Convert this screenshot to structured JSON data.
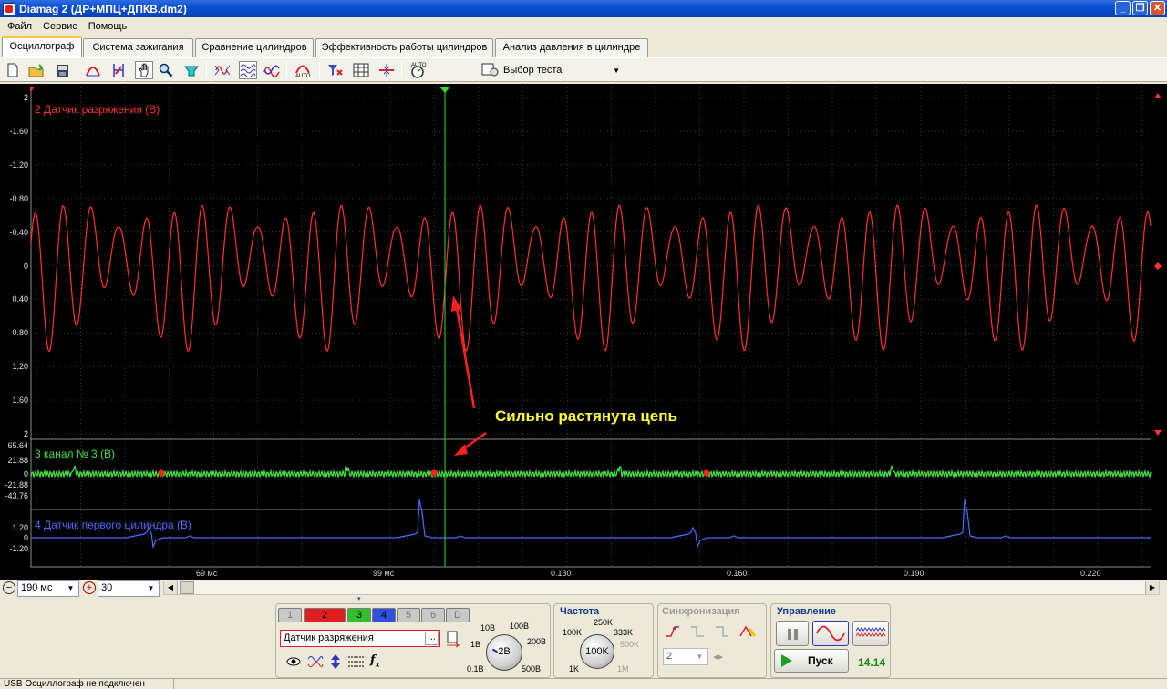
{
  "window": {
    "title": "Diamag 2 (ДР+МПЦ+ДПКВ.dm2)"
  },
  "menu": [
    "Файл",
    "Сервис",
    "Помощь"
  ],
  "tabs": [
    {
      "label": "Осциллограф",
      "active": true
    },
    {
      "label": "Система зажигания"
    },
    {
      "label": "Сравнение цилиндров"
    },
    {
      "label": "Эффективность работы цилиндров"
    },
    {
      "label": "Анализ давления в цилиндре"
    }
  ],
  "toolbar": {
    "test_select": "Выбор теста"
  },
  "channels": {
    "ch2": {
      "label": "2 Датчик разряжения (В)",
      "color": "#ff3030",
      "yticks": [
        "-2",
        "-1.60",
        "-1.20",
        "-0.80",
        "-0.40",
        "0",
        "0.40",
        "0.80",
        "1.20",
        "1.60",
        "2"
      ]
    },
    "ch3": {
      "label": "3 канал № 3 (В)",
      "color": "#40e040",
      "yticks": [
        "65.64",
        "21.88",
        "0",
        "-21.88",
        "-43.76"
      ]
    },
    "ch4": {
      "label": "4 Датчик первого цилиндра (В)",
      "color": "#4a6cff",
      "yticks": [
        "1.20",
        "0",
        "-1.20"
      ]
    }
  },
  "xaxis": {
    "ticks": [
      "69 мс",
      "99 мс",
      "0.130",
      "0.160",
      "0.190",
      "0.220"
    ]
  },
  "annotation": {
    "text": "Сильно растянута цепь",
    "color": "#ffff30"
  },
  "timebase": {
    "value": "190 мс"
  },
  "zoom": {
    "value": "30"
  },
  "panel": {
    "channel_buttons": [
      {
        "label": "1",
        "bg": "#c8c8c8"
      },
      {
        "label": "2",
        "bg": "#e02020",
        "selected": true
      },
      {
        "label": "3",
        "bg": "#30c030"
      },
      {
        "label": "4",
        "bg": "#3050e0"
      },
      {
        "label": "5",
        "bg": "#c8c8c8"
      },
      {
        "label": "6",
        "bg": "#c8c8c8"
      },
      {
        "label": "D",
        "bg": "#c8c8c8"
      }
    ],
    "sensor_field": "Датчик разряжения",
    "sensor_more": "...",
    "voltage_knob": {
      "value": "2В",
      "labels": [
        "10В",
        "100В",
        "1В",
        "200В",
        "0.1В",
        "500В"
      ]
    },
    "freq": {
      "title": "Частота",
      "value": "100K",
      "labels": [
        "250K",
        "100K",
        "333K",
        "500K",
        "1K",
        "1M"
      ]
    },
    "sync": {
      "title": "Синхронизация",
      "channel": "2"
    },
    "control": {
      "title": "Управление",
      "start_label": "Пуск",
      "readout": "14.14"
    }
  },
  "status": {
    "text": "USB Осциллограф не подключен"
  }
}
